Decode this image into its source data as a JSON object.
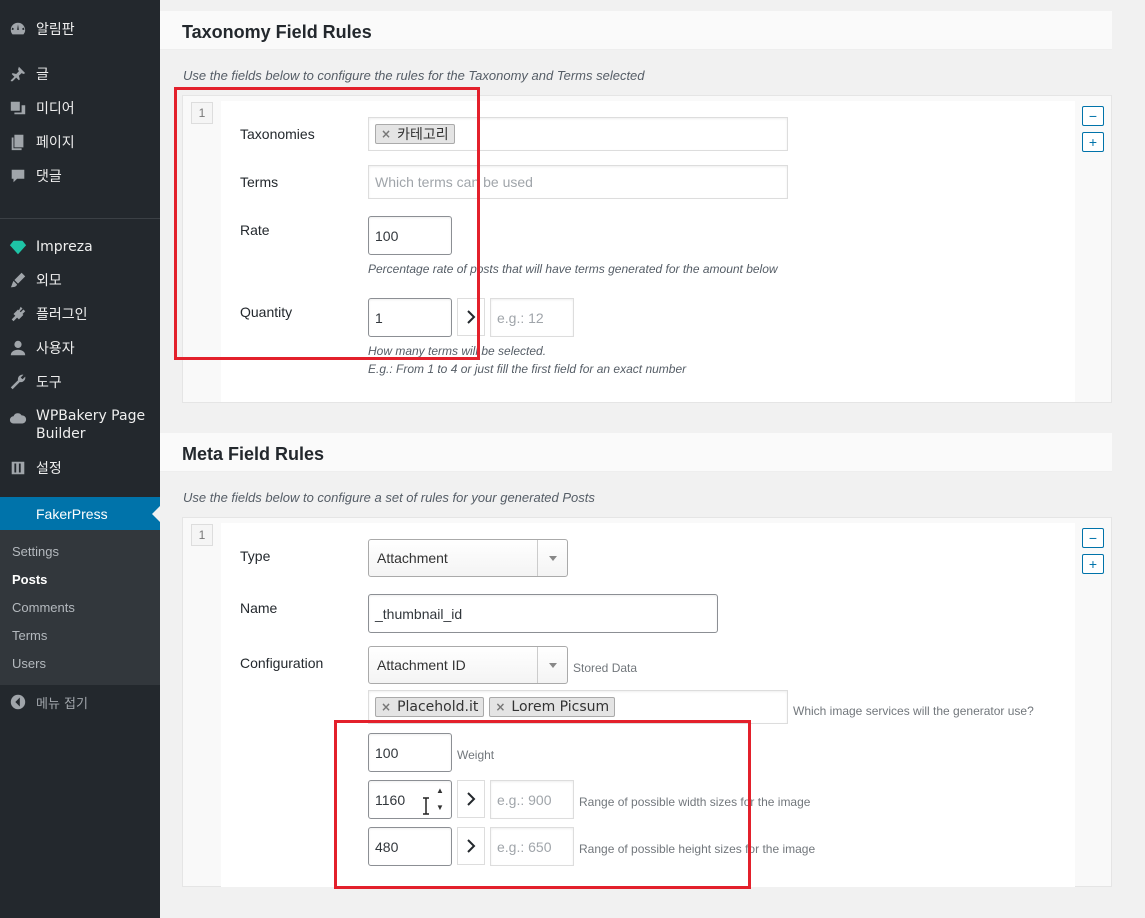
{
  "sidebar": {
    "items": [
      {
        "label": "알림판",
        "icon": "dashboard-icon"
      },
      {
        "label": "글",
        "icon": "pin-icon"
      },
      {
        "label": "미디어",
        "icon": "media-icon"
      },
      {
        "label": "페이지",
        "icon": "pages-icon"
      },
      {
        "label": "댓글",
        "icon": "comments-icon"
      },
      {
        "label": "Impreza",
        "icon": "diamond-icon"
      },
      {
        "label": "외모",
        "icon": "brush-icon"
      },
      {
        "label": "플러그인",
        "icon": "plugin-icon"
      },
      {
        "label": "사용자",
        "icon": "user-icon"
      },
      {
        "label": "도구",
        "icon": "wrench-icon"
      },
      {
        "label": "WPBakery Page Builder",
        "icon": "cloud-icon"
      },
      {
        "label": "설정",
        "icon": "settings-icon"
      }
    ],
    "active": "FakerPress",
    "submenu": [
      "Settings",
      "Posts",
      "Comments",
      "Terms",
      "Users"
    ],
    "collapse": "메뉴 접기"
  },
  "taxonomy": {
    "title": "Taxonomy Field Rules",
    "description": "Use the fields below to configure the rules for the Taxonomy and Terms selected",
    "rule_number": "1",
    "taxonomies_label": "Taxonomies",
    "taxonomy_token": "카테고리",
    "terms_label": "Terms",
    "terms_placeholder": "Which terms can be used",
    "rate_label": "Rate",
    "rate_value": "100",
    "rate_help": "Percentage rate of posts that will have terms generated for the amount below",
    "quantity_label": "Quantity",
    "quantity_min": "1",
    "quantity_max_placeholder": "e.g.: 12",
    "quantity_help_1": "How many terms will be selected.",
    "quantity_help_2": "E.g.: From 1 to 4 or just fill the first field for an exact number",
    "minus": "−",
    "plus": "+"
  },
  "meta": {
    "title": "Meta Field Rules",
    "description": "Use the fields below to configure a set of rules for your generated Posts",
    "rule_number": "1",
    "type_label": "Type",
    "type_value": "Attachment",
    "name_label": "Name",
    "name_value": "_thumbnail_id",
    "config_label": "Configuration",
    "config_value": "Attachment ID",
    "config_note": "Stored Data",
    "services": [
      "Placehold.it",
      "Lorem Picsum"
    ],
    "services_note": "Which image services will the generator use?",
    "weight_value": "100",
    "weight_note": "Weight",
    "width_value": "1160",
    "width_max_placeholder": "e.g.: 900",
    "width_note": "Range of possible width sizes for the image",
    "height_value": "480",
    "height_max_placeholder": "e.g.: 650",
    "height_note": "Range of possible height sizes for the image",
    "minus": "−",
    "plus": "+"
  },
  "colors": {
    "sidebar_bg": "#23282d",
    "accent": "#0073aa",
    "highlight_border": "#e3202b"
  }
}
